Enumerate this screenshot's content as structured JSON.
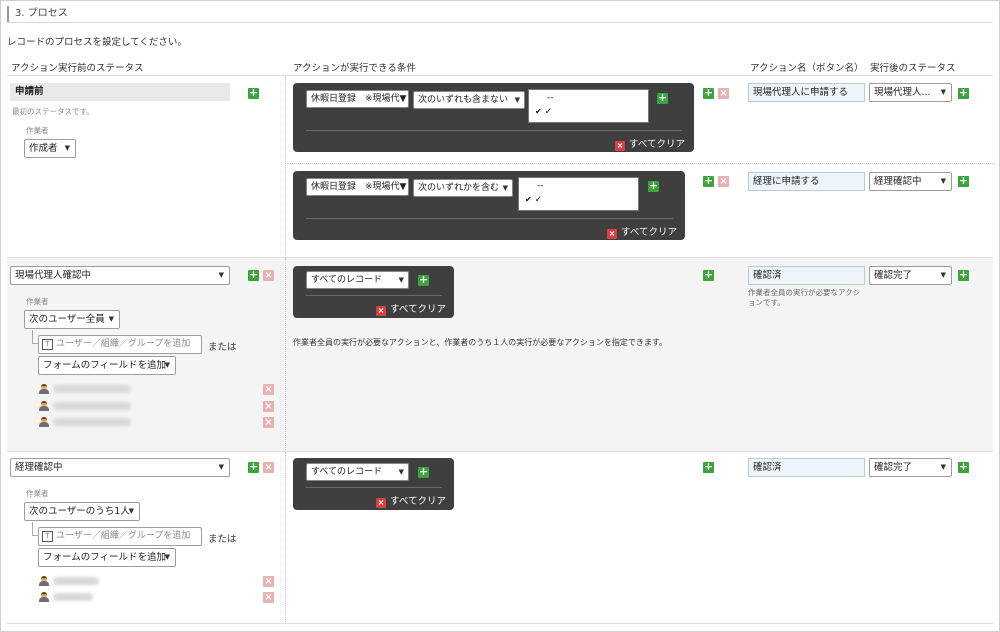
{
  "section": {
    "title": "3. プロセス",
    "intro": "レコードのプロセスを設定してください。"
  },
  "columns": {
    "status_before": "アクション実行前のステータス",
    "conditions": "アクションが実行できる条件",
    "action_name": "アクション名（ボタン名）",
    "status_after": "実行後のステータス"
  },
  "row1": {
    "status": "申請前",
    "status_note": "最初のステータスです。",
    "assignee_label": "作業者",
    "assignee_select": "作成者",
    "actions": [
      {
        "field": "休暇日登録　※現場代▼",
        "operator": "次のいずれも含まない",
        "options": [
          "--",
          "✓"
        ],
        "clear": "すべてクリア",
        "action_name": "現場代理人に申請する",
        "status_after": "現場代理人..."
      },
      {
        "field": "休暇日登録　※現場代▼",
        "operator": "次のいずれかを含む",
        "options": [
          "--",
          "✓"
        ],
        "clear": "すべてクリア",
        "action_name": "経理に申請する",
        "status_after": "経理確認中"
      }
    ]
  },
  "row2": {
    "status": "現場代理人確認中",
    "assignee_label": "作業者",
    "assignee_select": "次のユーザー全員",
    "user_placeholder": "ユーザー／組織／グループを追加",
    "or": "または",
    "field_select": "フォームのフィールドを追加",
    "condition": "すべてのレコード",
    "clear": "すべてクリア",
    "description": "作業者全員の実行が必要なアクションと、作業者のうち１人の実行が必要なアクションを指定できます。",
    "action_name": "確認済",
    "action_note": "作業者全員の実行が必要なアクションです。",
    "status_after": "確認完了"
  },
  "row3": {
    "status": "経理確認中",
    "assignee_label": "作業者",
    "assignee_select": "次のユーザーのうち1人",
    "user_placeholder": "ユーザー／組織／グループを追加",
    "or": "または",
    "field_select": "フォームのフィールドを追加",
    "condition": "すべてのレコード",
    "clear": "すべてクリア",
    "action_name": "確認済",
    "status_after": "確認完了"
  }
}
